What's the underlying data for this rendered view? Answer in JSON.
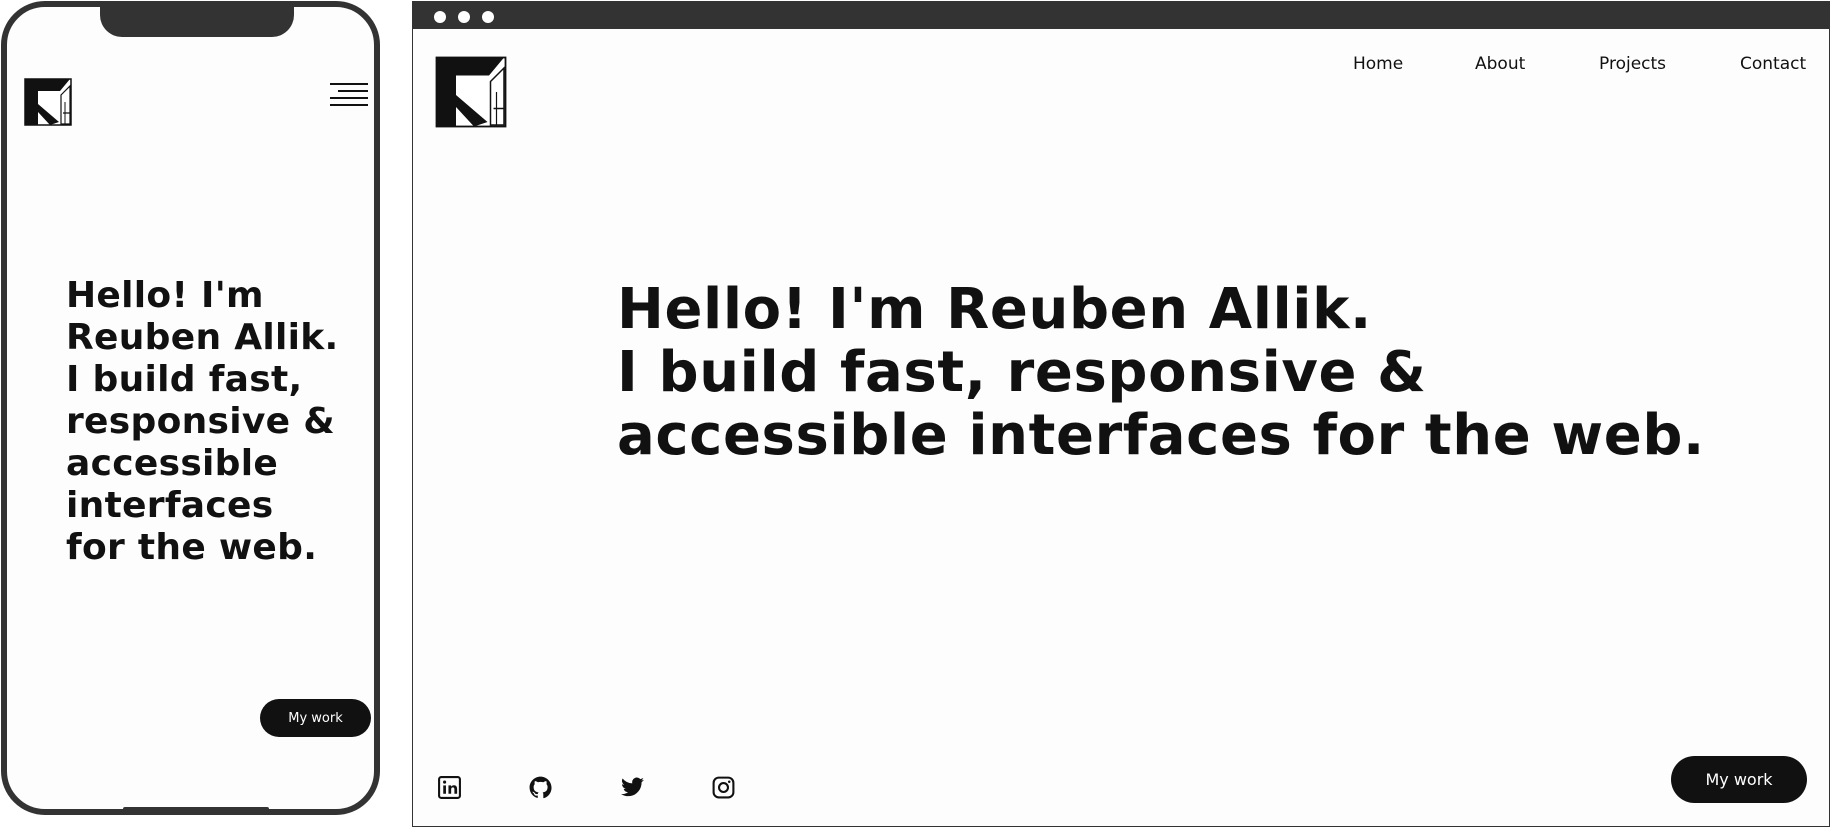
{
  "brand": {
    "logo_icon": "ra-monogram-logo-icon"
  },
  "hero": {
    "line1": "Hello! I'm Reuben Allik.",
    "line2": "I build fast, responsive &",
    "line3": "accessible interfaces for the web.",
    "mobile_lines": [
      "Hello! I'm",
      "Reuben Allik.",
      "I build fast,",
      "responsive &",
      "accessible",
      "interfaces",
      "for the web."
    ]
  },
  "nav": {
    "items": [
      {
        "label": "Home"
      },
      {
        "label": "About"
      },
      {
        "label": "Projects"
      },
      {
        "label": "Contact"
      }
    ]
  },
  "cta": {
    "label": "My work"
  },
  "social": {
    "icons": [
      "linkedin-icon",
      "github-icon",
      "twitter-icon",
      "instagram-icon"
    ]
  },
  "mobile": {
    "menu_icon": "hamburger-menu-icon"
  },
  "colors": {
    "text": "#111111",
    "background": "#fdfdfd",
    "frame": "#333333",
    "button_bg": "#111111",
    "button_text": "#ffffff"
  }
}
